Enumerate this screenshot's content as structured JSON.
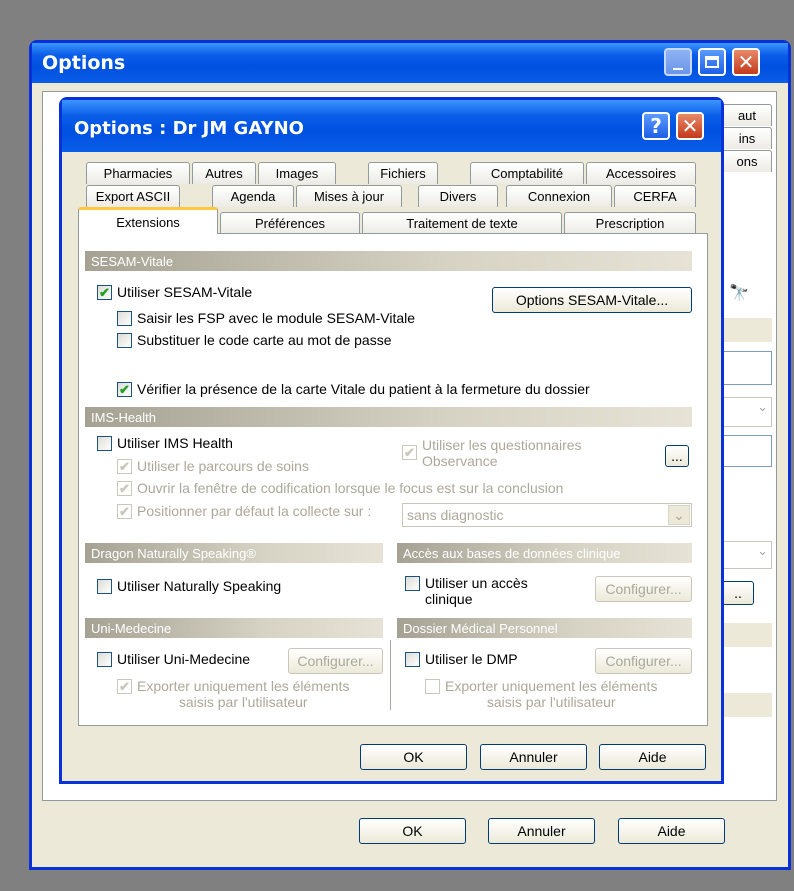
{
  "outer": {
    "title": "Options",
    "tabs_right": [
      "aut",
      "ins",
      "ons"
    ],
    "buttons": {
      "ok": "OK",
      "cancel": "Annuler",
      "help": "Aide"
    }
  },
  "inner": {
    "title": "Options : Dr  JM GAYNO",
    "help_glyph": "?",
    "close_glyph": "✕",
    "tabs_row1": [
      "Pharmacies",
      "Autres",
      "Images",
      "Fichiers",
      "Comptabilité",
      "Accessoires"
    ],
    "tabs_row2": [
      "Export ASCII",
      "Agenda",
      "Mises à jour",
      "Divers",
      "Connexion",
      "CERFA"
    ],
    "tabs_row3": [
      "Extensions",
      "Préférences",
      "Traitement de texte",
      "Prescription"
    ],
    "sesam": {
      "header": "SESAM-Vitale",
      "use": "Utiliser SESAM-Vitale",
      "fsp": "Saisir les FSP avec le module SESAM-Vitale",
      "code": "Substituer le code carte au mot de passe",
      "verify": "Vérifier la présence de la carte Vitale du patient à la fermeture du dossier",
      "options_button": "Options SESAM-Vitale..."
    },
    "ims": {
      "header": "IMS-Health",
      "use": "Utiliser IMS Health",
      "questionnaires_line1": "Utiliser les questionnaires",
      "questionnaires_line2": "Observance",
      "ellipsis": "...",
      "parcours": "Utiliser le parcours de soins",
      "codification": "Ouvrir la fenêtre de codification lorsque le focus est sur la conclusion",
      "collecte": "Positionner par défaut la collecte sur :",
      "collecte_value": "sans diagnostic"
    },
    "dragon": {
      "header": "Dragon Naturally Speaking®",
      "use": "Utiliser Naturally Speaking"
    },
    "acces": {
      "header": "Accès aux bases de données clinique",
      "use_line1": "Utiliser un accès",
      "use_line2": "clinique",
      "configure": "Configurer..."
    },
    "uni": {
      "header": "Uni-Medecine",
      "use": "Utiliser Uni-Medecine",
      "configure": "Configurer...",
      "export_line1": "Exporter uniquement les éléments",
      "export_line2": "saisis par l'utilisateur"
    },
    "dmp": {
      "header": "Dossier Médical Personnel",
      "use": "Utiliser le DMP",
      "configure": "Configurer...",
      "export_line1": "Exporter uniquement les éléments",
      "export_line2": "saisis par l'utilisateur"
    },
    "buttons": {
      "ok": "OK",
      "cancel": "Annuler",
      "help": "Aide"
    }
  },
  "glyphs": {
    "check": "✔",
    "dropdown": "⌄",
    "binoculars": "🔭",
    "minimize": "_",
    "maximize": "☐",
    "close": "✕"
  }
}
